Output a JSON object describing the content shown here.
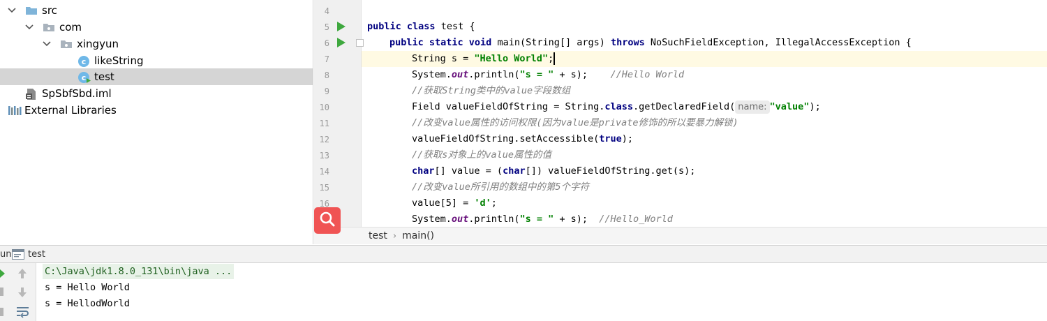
{
  "project_tree": {
    "items": [
      {
        "label": "src",
        "icon": "folder-icon"
      },
      {
        "label": "com",
        "icon": "package-icon"
      },
      {
        "label": "xingyun",
        "icon": "package-icon"
      },
      {
        "label": "likeString",
        "icon": "class-icon"
      },
      {
        "label": "test",
        "icon": "class-runnable-icon"
      },
      {
        "label": "SpSbfSbd.iml",
        "icon": "module-file-icon"
      },
      {
        "label": "External Libraries",
        "icon": "libraries-icon"
      }
    ]
  },
  "editor": {
    "line_numbers": [
      "4",
      "5",
      "6",
      "7",
      "8",
      "9",
      "10",
      "11",
      "12",
      "13",
      "14",
      "15",
      "16"
    ],
    "code": {
      "l5_public": "public",
      "l5_class": "class",
      "l5_rest": " test {",
      "l6_kw": "public static void",
      "l6_mid": " main(String[] args) ",
      "l6_throws": "throws",
      "l6_rest": " NoSuchFieldException, IllegalAccessException {",
      "l7_pre": "String s = ",
      "l7_str": "\"Hello World\"",
      "l7_post": ";",
      "l8_pre": "System.",
      "l8_field": "out",
      "l8_mid": ".println(",
      "l8_str": "\"s = \"",
      "l8_post": " + s);    ",
      "l8_cmt": "//Hello World",
      "l9_cmt": "//获取String类中的value字段数组",
      "l10_pre": "Field valueFieldOfString = String.",
      "l10_kw": "class",
      "l10_mid": ".getDeclaredField(",
      "l10_hint": "name:",
      "l10_str": "\"value\"",
      "l10_post": ");",
      "l11_cmt": "//改变value属性的访问权限(因为value是private修饰的所以要暴力解锁)",
      "l12_pre": "valueFieldOfString.setAccessible(",
      "l12_kw": "true",
      "l12_post": ");",
      "l13_cmt": "//获取s对象上的value属性的值",
      "l14_kw1": "char",
      "l14_mid1": "[] value = (",
      "l14_kw2": "char",
      "l14_mid2": "[]) valueFieldOfString.get(s);",
      "l15_cmt": "//改变value所引用的数组中的第5个字符",
      "l16_pre": "value[5] = ",
      "l16_str": "'d'",
      "l16_post": ";",
      "l17_pre": "System.",
      "l17_field": "out",
      "l17_mid": ".println(",
      "l17_str": "\"s = \"",
      "l17_post": " + s);  ",
      "l17_cmt": "//Hello_World"
    }
  },
  "breadcrumb": {
    "items": [
      "test",
      "main()"
    ]
  },
  "run_panel": {
    "tab_prefix": "un",
    "tab_label": "test",
    "console_lines": [
      "C:\\Java\\jdk1.8.0_131\\bin\\java ...",
      "s = Hello World",
      "s = HellodWorld"
    ]
  },
  "colors": {
    "keyword": "#000080",
    "string": "#008000",
    "static_field": "#660e7a",
    "comment": "#808080",
    "run_green": "#3ea83e",
    "search_fab": "#f05454",
    "selection": "#d5d5d5",
    "current_line": "#fffae3"
  }
}
